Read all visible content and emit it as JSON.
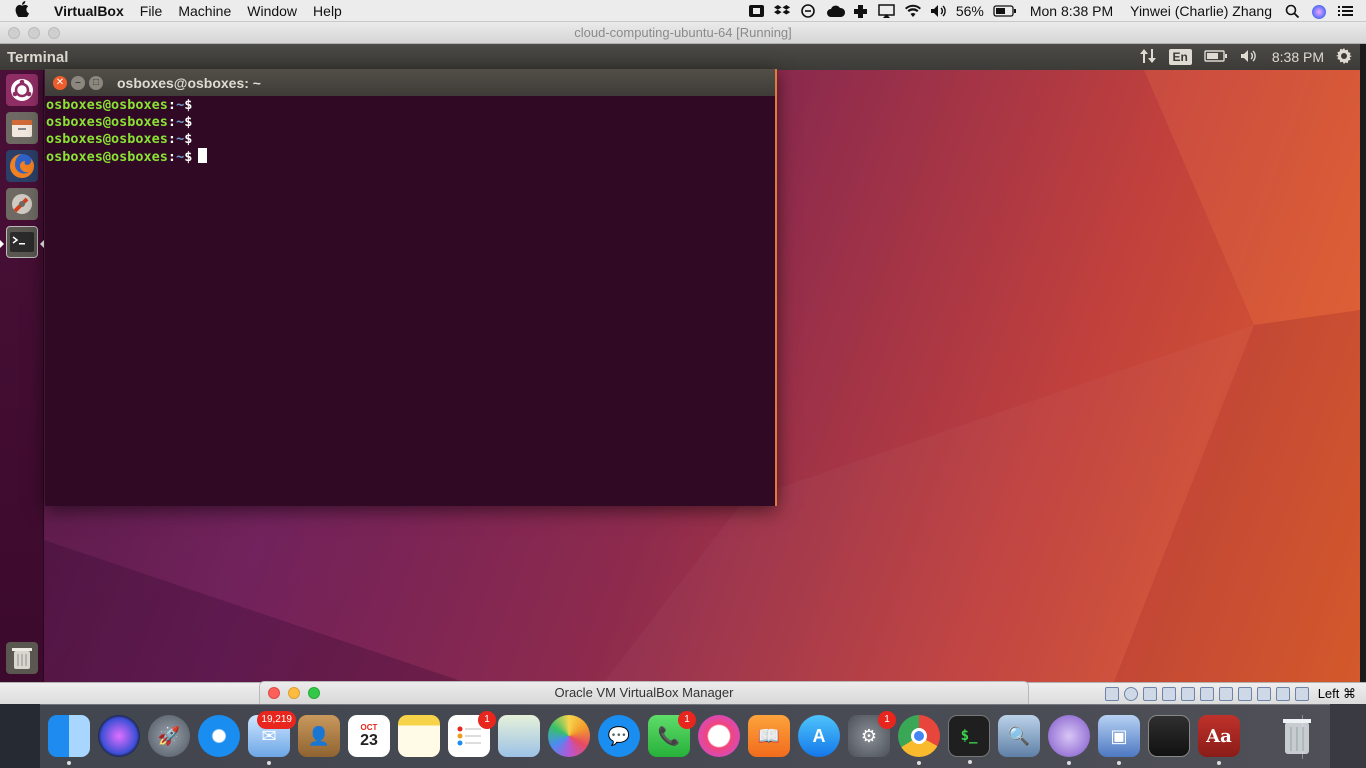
{
  "mac_menubar": {
    "app_name": "VirtualBox",
    "menus": [
      "File",
      "Machine",
      "Window",
      "Help"
    ],
    "battery": "56%",
    "clock": "Mon 8:38 PM",
    "user": "Yinwei (Charlie) Zhang",
    "status_icons": [
      "screen-icon",
      "dropbox-icon",
      "sync-icon",
      "cloud-icon",
      "plus-icon",
      "airplay-icon",
      "wifi-icon",
      "volume-icon",
      "battery-icon",
      "search-icon",
      "siri-icon",
      "list-icon"
    ]
  },
  "vbox_window": {
    "title": "cloud-computing-ubuntu-64 [Running]",
    "status_host_key": "Left ⌘"
  },
  "ubuntu_panel": {
    "title": "Terminal",
    "keyboard": "En",
    "clock": "8:38 PM"
  },
  "terminal": {
    "title": "osboxes@osboxes: ~",
    "lines": [
      {
        "user": "osboxes@osboxes",
        "sep": ":",
        "path": "~",
        "prompt": "$"
      },
      {
        "user": "osboxes@osboxes",
        "sep": ":",
        "path": "~",
        "prompt": "$"
      },
      {
        "user": "osboxes@osboxes",
        "sep": ":",
        "path": "~",
        "prompt": "$"
      },
      {
        "user": "osboxes@osboxes",
        "sep": ":",
        "path": "~",
        "prompt": "$"
      }
    ]
  },
  "launcher": {
    "items": [
      "ubuntu-dash-icon",
      "files-icon",
      "firefox-icon",
      "system-settings-icon",
      "terminal-icon",
      "trash-icon"
    ]
  },
  "vbox_manager": {
    "title": "Oracle VM VirtualBox Manager"
  },
  "dock": {
    "items": [
      {
        "name": "finder",
        "badge": ""
      },
      {
        "name": "siri",
        "badge": ""
      },
      {
        "name": "launchpad",
        "badge": ""
      },
      {
        "name": "safari",
        "badge": ""
      },
      {
        "name": "mail",
        "badge": "19,219"
      },
      {
        "name": "contacts",
        "badge": ""
      },
      {
        "name": "calendar",
        "badge": "",
        "month": "OCT",
        "day": "23"
      },
      {
        "name": "notes",
        "badge": ""
      },
      {
        "name": "reminders",
        "badge": "1"
      },
      {
        "name": "preview-maps",
        "badge": ""
      },
      {
        "name": "photos",
        "badge": ""
      },
      {
        "name": "messages",
        "badge": ""
      },
      {
        "name": "facetime",
        "badge": "1"
      },
      {
        "name": "itunes",
        "badge": ""
      },
      {
        "name": "ibooks",
        "badge": ""
      },
      {
        "name": "app-store",
        "badge": ""
      },
      {
        "name": "system-preferences",
        "badge": "1"
      },
      {
        "name": "chrome",
        "badge": ""
      },
      {
        "name": "terminal",
        "badge": ""
      },
      {
        "name": "preview",
        "badge": ""
      },
      {
        "name": "visual-studio",
        "badge": ""
      },
      {
        "name": "virtualbox",
        "badge": ""
      },
      {
        "name": "screen-recorder",
        "badge": ""
      },
      {
        "name": "dictionary",
        "badge": ""
      },
      {
        "name": "trash",
        "badge": ""
      }
    ]
  }
}
